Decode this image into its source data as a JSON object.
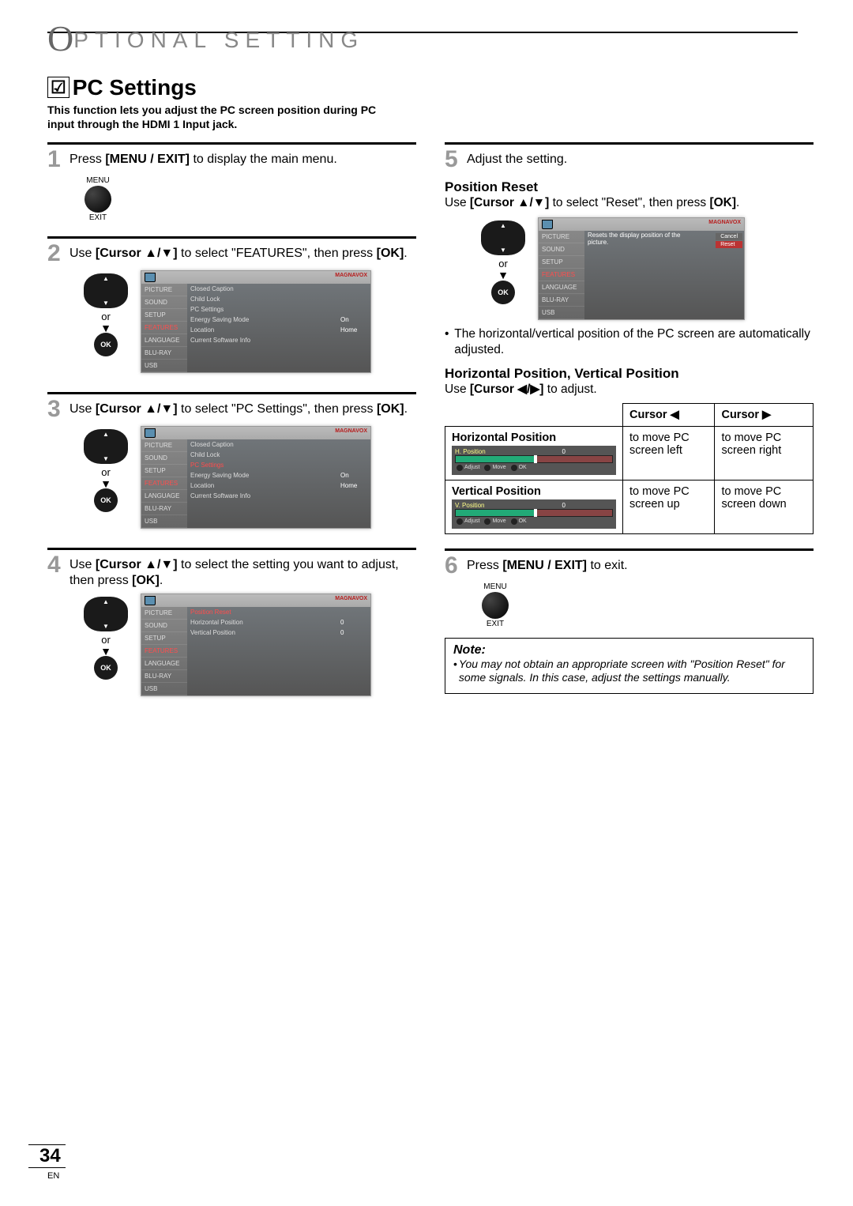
{
  "header": {
    "cap": "O",
    "rest": "PTIONAL SETTING"
  },
  "section": {
    "check_icon": "☑",
    "title": "PC Settings"
  },
  "intro": "This function lets you adjust the PC screen position during PC input through the HDMI 1 Input jack.",
  "steps": {
    "s1": {
      "num": "1",
      "text_a": "Press ",
      "bold1": "[MENU / EXIT]",
      "text_b": " to display the main menu."
    },
    "s2": {
      "num": "2",
      "text_a": "Use ",
      "bold1": "[Cursor ▲/▼]",
      "text_b": " to select \"FEATURES\", then press ",
      "bold2": "[OK]",
      "text_c": "."
    },
    "s3": {
      "num": "3",
      "text_a": "Use ",
      "bold1": "[Cursor ▲/▼]",
      "text_b": " to select \"PC Settings\", then press ",
      "bold2": "[OK]",
      "text_c": "."
    },
    "s4": {
      "num": "4",
      "text_a": "Use ",
      "bold1": "[Cursor ▲/▼]",
      "text_b": " to select the setting you want to adjust, then press ",
      "bold2": "[OK]",
      "text_c": "."
    },
    "s5": {
      "num": "5",
      "text": "Adjust the setting."
    },
    "s6": {
      "num": "6",
      "text_a": "Press ",
      "bold1": "[MENU / EXIT]",
      "text_b": " to exit."
    }
  },
  "remote": {
    "or": "or",
    "ok": "OK",
    "menu": "MENU",
    "exit": "EXIT",
    "down": "▼"
  },
  "tv": {
    "brand": "MAGNAVOX",
    "sidebar": [
      "PICTURE",
      "SOUND",
      "SETUP",
      "FEATURES",
      "LANGUAGE",
      "BLU-RAY",
      "USB"
    ],
    "screen2_rows": [
      {
        "lbl": "Closed Caption",
        "val": ""
      },
      {
        "lbl": "Child Lock",
        "val": ""
      },
      {
        "lbl": "PC Settings",
        "val": ""
      },
      {
        "lbl": "Energy Saving Mode",
        "val": "On"
      },
      {
        "lbl": "Location",
        "val": "Home"
      },
      {
        "lbl": "Current Software Info",
        "val": ""
      }
    ],
    "screen4_rows": [
      {
        "lbl": "Position Reset",
        "val": ""
      },
      {
        "lbl": "Horizontal Position",
        "val": "0"
      },
      {
        "lbl": "Vertical Position",
        "val": "0"
      }
    ],
    "screen5": {
      "desc": "Resets the display position of the picture.",
      "cancel": "Cancel",
      "reset": "Reset"
    }
  },
  "position_reset": {
    "heading": "Position Reset",
    "line_a": "Use ",
    "bold1": "[Cursor ▲/▼]",
    "line_b": " to select \"Reset\", then press ",
    "bold2": "[OK]",
    "line_c": ".",
    "bullet": "The horizontal/vertical position of the PC screen are automatically adjusted."
  },
  "hv_position": {
    "heading": "Horizontal Position, Vertical Position",
    "line_a": "Use ",
    "bold1": "[Cursor ◀/▶]",
    "line_b": " to adjust.",
    "th_left": "Cursor ◀",
    "th_right": "Cursor ▶",
    "row_h": "Horizontal Position",
    "h_left": "to move PC screen left",
    "h_right": "to move PC screen right",
    "row_v": "Vertical Position",
    "v_left": "to move PC screen up",
    "v_right": "to move PC screen down",
    "osd_h": "H. Position",
    "osd_v": "V. Position",
    "osd_0": "0",
    "hint_adjust": "Adjust",
    "hint_move": "Move",
    "hint_ok": "OK"
  },
  "note": {
    "title": "Note:",
    "item": "You may not obtain an appropriate screen with \"Position Reset\" for some signals. In this case, adjust the settings manually."
  },
  "page": {
    "num": "34",
    "lang": "EN"
  }
}
